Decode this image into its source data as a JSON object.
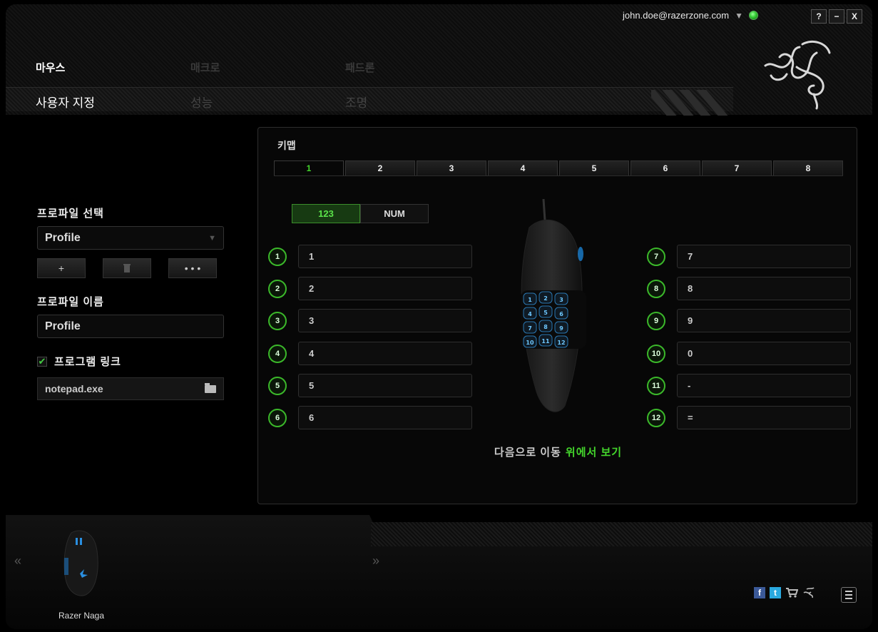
{
  "topbar": {
    "user_email": "john.doe@razerzone.com",
    "user_dropdown_icon": "▼",
    "status_color": "#3ccc3c",
    "help_label": "?",
    "minimize_label": "−",
    "close_label": "X"
  },
  "main_tabs": [
    {
      "label": "마우스",
      "active": true
    },
    {
      "label": "매크로",
      "active": false
    },
    {
      "label": "패드론",
      "active": false
    }
  ],
  "sub_tabs": [
    {
      "label": "사용자 지정",
      "active": true
    },
    {
      "label": "성능",
      "active": false
    },
    {
      "label": "조명",
      "active": false
    }
  ],
  "profile": {
    "select_label": "프로파일 선택",
    "selected": "Profile",
    "add_label": "+",
    "delete_icon": "trash-icon",
    "more_label": "• • •",
    "name_label": "프로파일 이름",
    "name_value": "Profile",
    "link_label": "프로그램 링크",
    "link_checked": true,
    "link_check_glyph": "✔",
    "exe_value": "notepad.exe"
  },
  "keymap": {
    "title": "키맵",
    "tabs": [
      "1",
      "2",
      "3",
      "4",
      "5",
      "6",
      "7",
      "8"
    ],
    "active_tab": "1",
    "mode_123": "123",
    "mode_num": "NUM",
    "left_buttons": [
      {
        "num": "1",
        "value": "1"
      },
      {
        "num": "2",
        "value": "2"
      },
      {
        "num": "3",
        "value": "3"
      },
      {
        "num": "4",
        "value": "4"
      },
      {
        "num": "5",
        "value": "5"
      },
      {
        "num": "6",
        "value": "6"
      }
    ],
    "right_buttons": [
      {
        "num": "7",
        "value": "7"
      },
      {
        "num": "8",
        "value": "8"
      },
      {
        "num": "9",
        "value": "9"
      },
      {
        "num": "10",
        "value": "0"
      },
      {
        "num": "11",
        "value": "-"
      },
      {
        "num": "12",
        "value": "="
      }
    ],
    "side_key_labels": [
      "1",
      "2",
      "3",
      "4",
      "5",
      "6",
      "7",
      "8",
      "9",
      "10",
      "11",
      "12"
    ],
    "goto_prefix": "다음으로 이동",
    "goto_link": "위에서 보기"
  },
  "footer": {
    "prev_arrow": "«",
    "next_arrow": "»",
    "device_name": "Razer Naga",
    "social": [
      "facebook-icon",
      "twitter-icon",
      "cart-icon",
      "razer-icon"
    ]
  },
  "colors": {
    "accent": "#44d62c",
    "background": "#000000"
  }
}
